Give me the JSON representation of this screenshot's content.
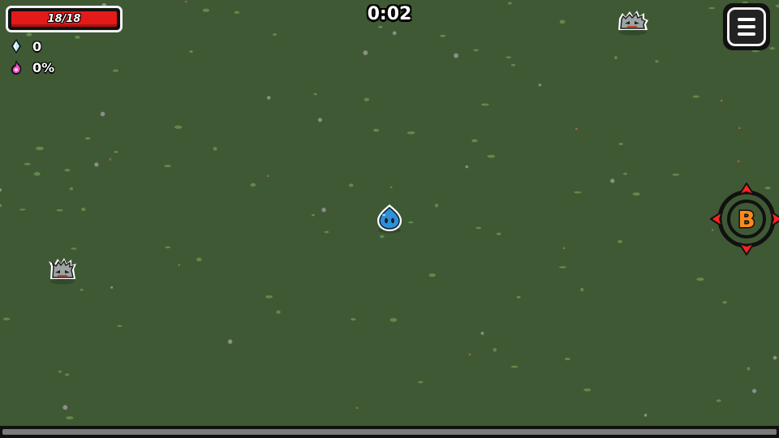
{
  "hud": {
    "health": {
      "current": 18,
      "max": 18,
      "label": "18/18",
      "color": "#e31a1a"
    },
    "gems": {
      "icon": "crystal-icon",
      "value": "0",
      "color": "#bfe8ff"
    },
    "souls": {
      "icon": "pink-flame-icon",
      "value": "0%",
      "color": "#ff4fd0"
    },
    "timer": "0:02",
    "menu": {
      "icon": "hamburger-menu-icon"
    },
    "xp": {
      "fraction": 0.0
    }
  },
  "world": {
    "ground_color": "#3f5934",
    "player": {
      "icon": "blue-slime-drop-icon",
      "color": "#2f8fd8"
    },
    "enemies": [
      {
        "icon": "gray-spiky-blob-icon"
      },
      {
        "icon": "gray-spiky-blob-icon"
      }
    ],
    "boss_indicator": {
      "icon": "boss-target-reticle-icon",
      "letter": "B",
      "color": "#ff2222",
      "letter_color": "#ff8a1a"
    }
  }
}
